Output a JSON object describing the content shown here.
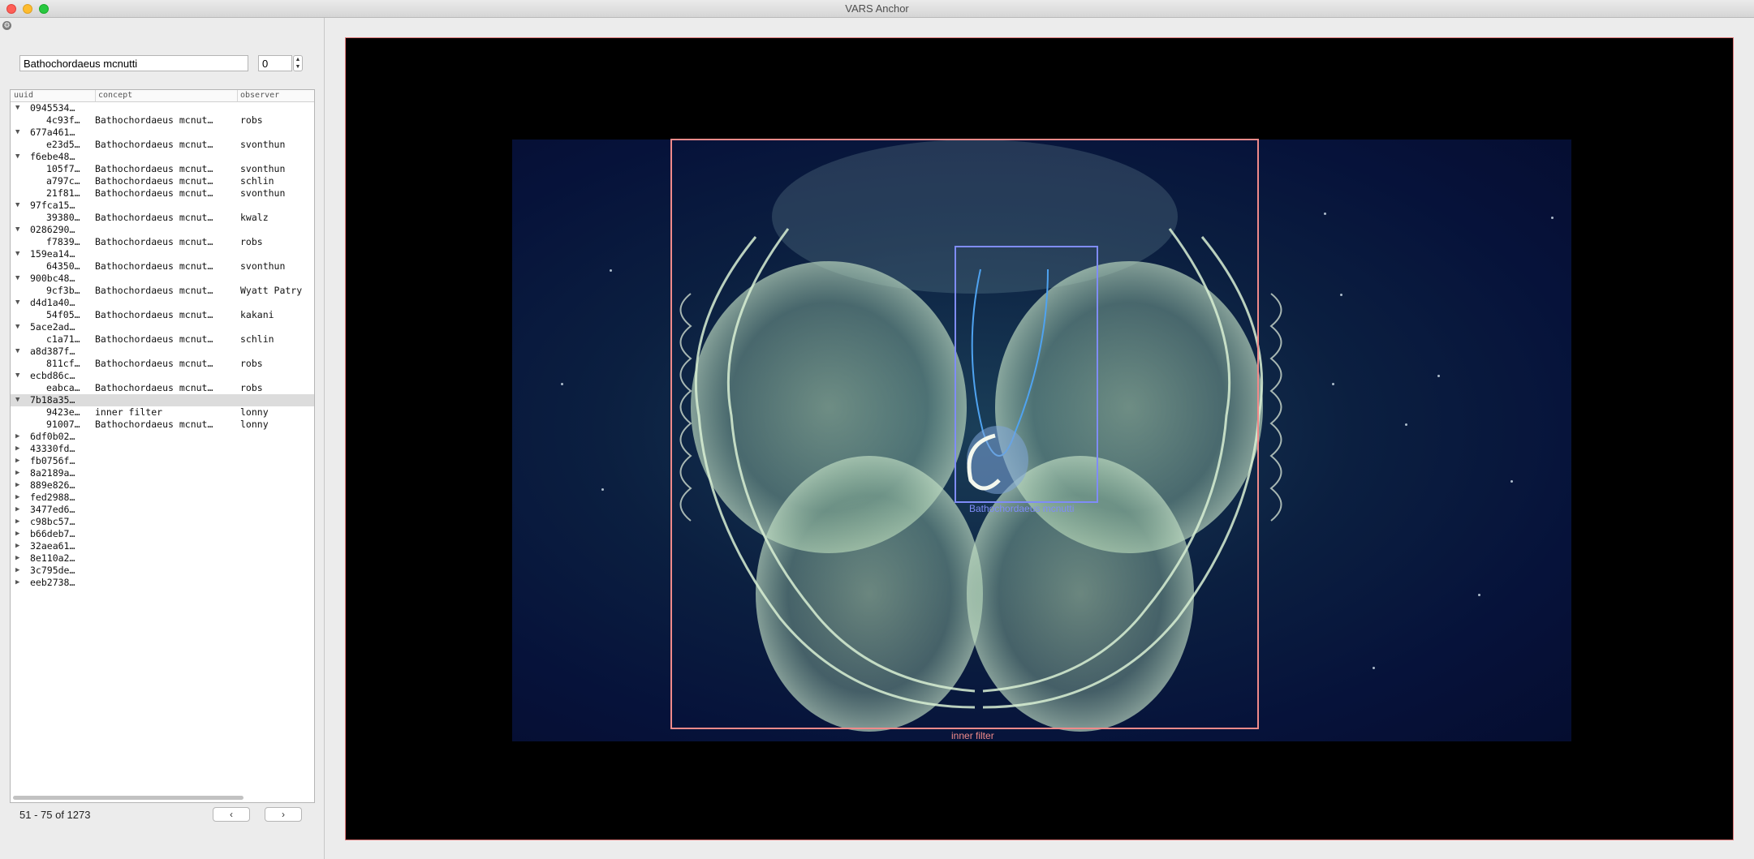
{
  "window": {
    "title": "VARS Anchor"
  },
  "search": {
    "value": "Bathochordaeus mcnutti",
    "index_value": "0"
  },
  "table": {
    "headers": {
      "uuid": "uuid",
      "concept": "concept",
      "observer": "observer"
    },
    "rows": [
      {
        "level": 0,
        "expanded": true,
        "uuid": "0945534…"
      },
      {
        "level": 1,
        "uuid": "4c93f…",
        "concept": "Bathochordaeus mcnut…",
        "observer": "robs"
      },
      {
        "level": 0,
        "expanded": true,
        "uuid": "677a461…"
      },
      {
        "level": 1,
        "uuid": "e23d5…",
        "concept": "Bathochordaeus mcnut…",
        "observer": "svonthun"
      },
      {
        "level": 0,
        "expanded": true,
        "uuid": "f6ebe48…"
      },
      {
        "level": 1,
        "uuid": "105f7…",
        "concept": "Bathochordaeus mcnut…",
        "observer": "svonthun"
      },
      {
        "level": 1,
        "uuid": "a797c…",
        "concept": "Bathochordaeus mcnut…",
        "observer": "schlin"
      },
      {
        "level": 1,
        "uuid": "21f81…",
        "concept": "Bathochordaeus mcnut…",
        "observer": "svonthun"
      },
      {
        "level": 0,
        "expanded": true,
        "uuid": "97fca15…"
      },
      {
        "level": 1,
        "uuid": "39380…",
        "concept": "Bathochordaeus mcnut…",
        "observer": "kwalz"
      },
      {
        "level": 0,
        "expanded": true,
        "uuid": "0286290…"
      },
      {
        "level": 1,
        "uuid": "f7839…",
        "concept": "Bathochordaeus mcnut…",
        "observer": "robs"
      },
      {
        "level": 0,
        "expanded": true,
        "uuid": "159ea14…"
      },
      {
        "level": 1,
        "uuid": "64350…",
        "concept": "Bathochordaeus mcnut…",
        "observer": "svonthun"
      },
      {
        "level": 0,
        "expanded": true,
        "uuid": "900bc48…"
      },
      {
        "level": 1,
        "uuid": "9cf3b…",
        "concept": "Bathochordaeus mcnut…",
        "observer": "Wyatt Patry"
      },
      {
        "level": 0,
        "expanded": true,
        "uuid": "d4d1a40…"
      },
      {
        "level": 1,
        "uuid": "54f05…",
        "concept": "Bathochordaeus mcnut…",
        "observer": "kakani"
      },
      {
        "level": 0,
        "expanded": true,
        "uuid": "5ace2ad…"
      },
      {
        "level": 1,
        "uuid": "c1a71…",
        "concept": "Bathochordaeus mcnut…",
        "observer": "schlin"
      },
      {
        "level": 0,
        "expanded": true,
        "uuid": "a8d387f…"
      },
      {
        "level": 1,
        "uuid": "811cf…",
        "concept": "Bathochordaeus mcnut…",
        "observer": "robs"
      },
      {
        "level": 0,
        "expanded": true,
        "uuid": "ecbd86c…"
      },
      {
        "level": 1,
        "uuid": "eabca…",
        "concept": "Bathochordaeus mcnut…",
        "observer": "robs"
      },
      {
        "level": 0,
        "expanded": true,
        "selected": true,
        "uuid": "7b18a35…"
      },
      {
        "level": 1,
        "uuid": "9423e…",
        "concept": "inner filter",
        "observer": "lonny"
      },
      {
        "level": 1,
        "uuid": "91007…",
        "concept": "Bathochordaeus mcnut…",
        "observer": "lonny"
      },
      {
        "level": 0,
        "expanded": false,
        "uuid": "6df0b02…"
      },
      {
        "level": 0,
        "expanded": false,
        "uuid": "43330fd…"
      },
      {
        "level": 0,
        "expanded": false,
        "uuid": "fb0756f…"
      },
      {
        "level": 0,
        "expanded": false,
        "uuid": "8a2189a…"
      },
      {
        "level": 0,
        "expanded": false,
        "uuid": "889e826…"
      },
      {
        "level": 0,
        "expanded": false,
        "uuid": "fed2988…"
      },
      {
        "level": 0,
        "expanded": false,
        "uuid": "3477ed6…"
      },
      {
        "level": 0,
        "expanded": false,
        "uuid": "c98bc57…"
      },
      {
        "level": 0,
        "expanded": false,
        "uuid": "b66deb7…"
      },
      {
        "level": 0,
        "expanded": false,
        "uuid": "32aea61…"
      },
      {
        "level": 0,
        "expanded": false,
        "uuid": "8e110a2…"
      },
      {
        "level": 0,
        "expanded": false,
        "uuid": "3c795de…"
      },
      {
        "level": 0,
        "expanded": false,
        "uuid": "eeb2738…"
      }
    ]
  },
  "pager": {
    "text": "51 - 75 of 1273",
    "prev_icon": "chevron-left-icon",
    "next_icon": "chevron-right-icon"
  },
  "viewer": {
    "annotations": [
      {
        "label": "Bathochordaeus mcnutti",
        "color": "#7f8cf8"
      },
      {
        "label": "inner filter",
        "color": "#f08a8a"
      }
    ]
  },
  "colors": {
    "outer_box": "#f08a8a",
    "inner_box": "#7f8cf8",
    "viewer_border": "#e07a7a"
  }
}
